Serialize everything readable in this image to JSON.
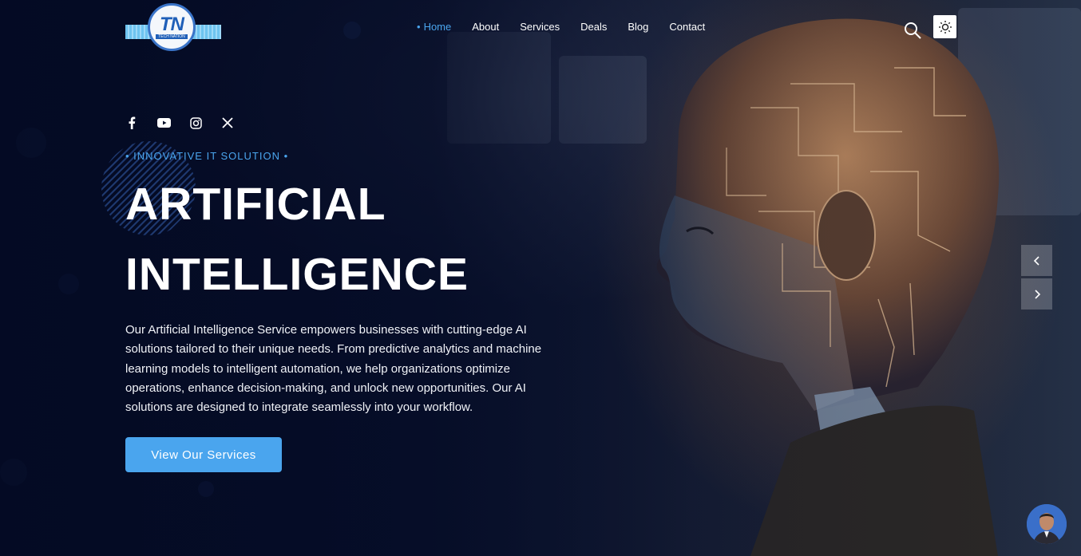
{
  "brand": {
    "logo_text": "TN",
    "logo_sub": "TECH NATION"
  },
  "nav": {
    "items": [
      {
        "label": "Home",
        "active": true
      },
      {
        "label": "About",
        "active": false
      },
      {
        "label": "Services",
        "active": false
      },
      {
        "label": "Deals",
        "active": false
      },
      {
        "label": "Blog",
        "active": false
      },
      {
        "label": "Contact",
        "active": false
      }
    ]
  },
  "header_icons": {
    "search": "search-icon",
    "theme": "sun-icon"
  },
  "social": [
    "facebook-icon",
    "youtube-icon",
    "instagram-icon",
    "x-icon"
  ],
  "hero": {
    "eyebrow": "• INNOVATIVE IT SOLUTION •",
    "title_line1": "ARTIFICIAL",
    "title_line2": "INTELLIGENCE",
    "description": "Our Artificial Intelligence Service empowers businesses with cutting-edge AI solutions tailored to their unique needs. From predictive analytics and machine learning models to intelligent automation, we help organizations optimize operations, enhance decision-making, and unlock new opportunities. Our AI solutions are designed to integrate seamlessly into your workflow.",
    "cta_label": "View Our Services"
  },
  "slider": {
    "prev_icon": "chevron-left-icon",
    "next_icon": "chevron-right-icon"
  },
  "colors": {
    "accent": "#4aa5ee",
    "background": "#07102a"
  }
}
